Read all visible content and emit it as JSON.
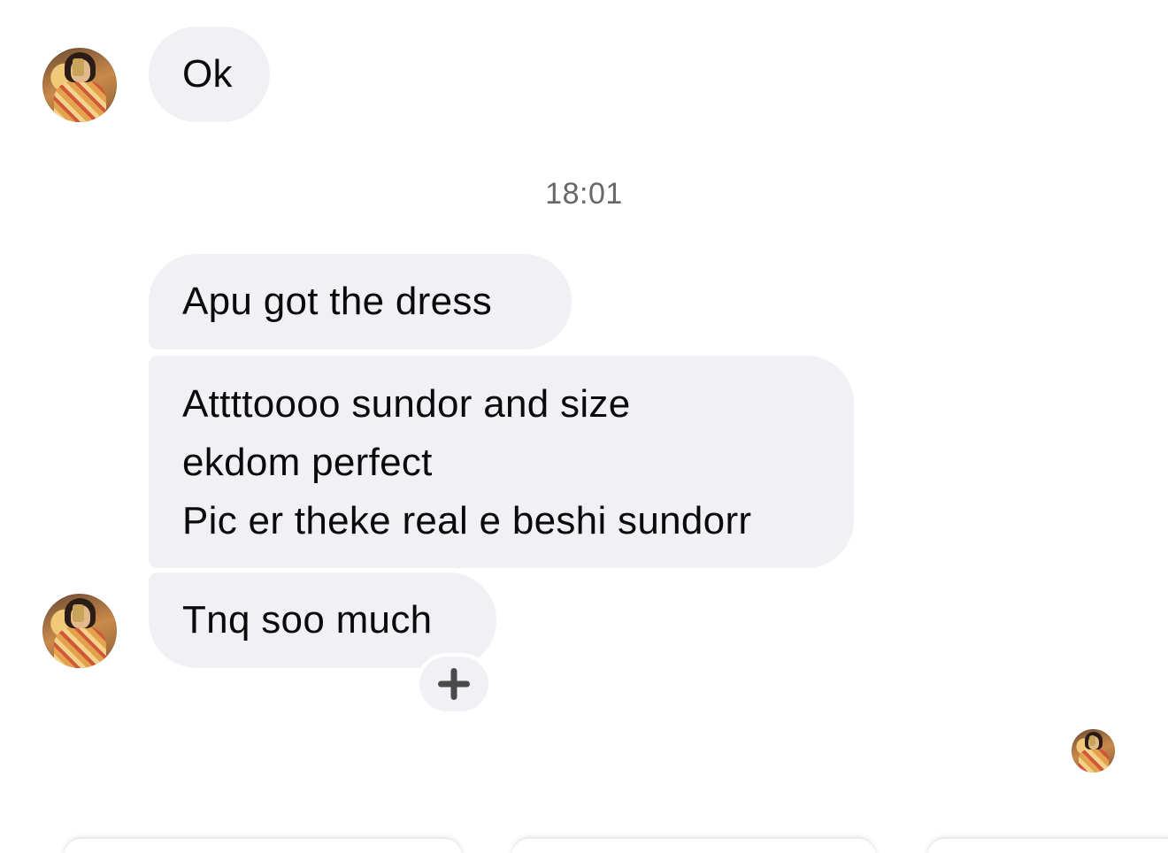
{
  "messages": [
    {
      "text": "Ok"
    },
    {
      "text": "Apu got the dress"
    },
    {
      "lines": [
        "Attttoooo sundor and size",
        "ekdom perfect",
        "Pic er theke real e beshi sundorr"
      ]
    },
    {
      "text": "Tnq soo much"
    }
  ],
  "timestamp": "18:01",
  "icons": {
    "avatar": "contact-avatar",
    "react": "plus-icon",
    "read_receipt": "seen-avatar"
  },
  "colors": {
    "bubble_bg": "#f0f0f5",
    "timestamp": "#65676b",
    "react_icon": "#4a4a4a"
  }
}
